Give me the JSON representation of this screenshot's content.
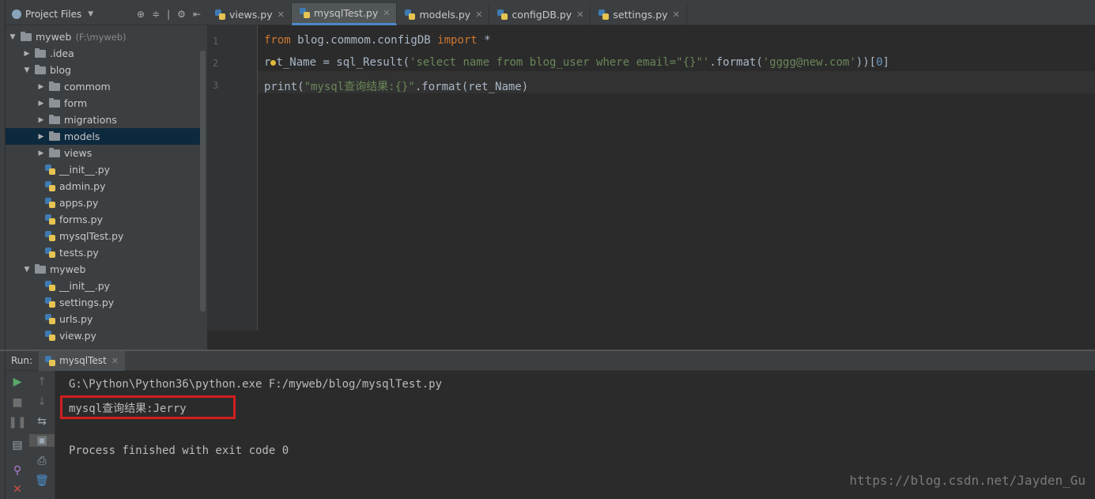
{
  "project_panel": {
    "title": "Project Files",
    "tree": [
      {
        "label": "myweb",
        "path": "(F:\\myweb)",
        "type": "folder",
        "depth": 0,
        "expanded": true
      },
      {
        "label": ".idea",
        "type": "folder",
        "depth": 1,
        "expanded": false
      },
      {
        "label": "blog",
        "type": "folder",
        "depth": 1,
        "expanded": true
      },
      {
        "label": "commom",
        "type": "folder",
        "depth": 2,
        "expanded": false
      },
      {
        "label": "form",
        "type": "folder",
        "depth": 2,
        "expanded": false
      },
      {
        "label": "migrations",
        "type": "folder",
        "depth": 2,
        "expanded": false
      },
      {
        "label": "models",
        "type": "folder",
        "depth": 2,
        "expanded": false,
        "selected": true
      },
      {
        "label": "views",
        "type": "folder",
        "depth": 2,
        "expanded": false
      },
      {
        "label": "__init__.py",
        "type": "file",
        "depth": 2
      },
      {
        "label": "admin.py",
        "type": "file",
        "depth": 2
      },
      {
        "label": "apps.py",
        "type": "file",
        "depth": 2
      },
      {
        "label": "forms.py",
        "type": "file",
        "depth": 2
      },
      {
        "label": "mysqlTest.py",
        "type": "file",
        "depth": 2
      },
      {
        "label": "tests.py",
        "type": "file",
        "depth": 2
      },
      {
        "label": "myweb",
        "type": "folder",
        "depth": 1,
        "expanded": true
      },
      {
        "label": "__init__.py",
        "type": "file",
        "depth": 2
      },
      {
        "label": "settings.py",
        "type": "file",
        "depth": 2
      },
      {
        "label": "urls.py",
        "type": "file",
        "depth": 2
      },
      {
        "label": "view.py",
        "type": "file",
        "depth": 2
      }
    ]
  },
  "editor_tabs": [
    {
      "label": "views.py",
      "active": false
    },
    {
      "label": "mysqlTest.py",
      "active": true
    },
    {
      "label": "models.py",
      "active": false
    },
    {
      "label": "configDB.py",
      "active": false
    },
    {
      "label": "settings.py",
      "active": false
    }
  ],
  "code": {
    "line_numbers": [
      "1",
      "2",
      "3"
    ],
    "line1": {
      "kw1": "from",
      "mod": " blog.commom.configDB ",
      "kw2": "import",
      "rest": " *"
    },
    "line2": {
      "a": "r",
      "b": "t_Name = sql_Result(",
      "s": "'select name from blog_user where email=\"{}\"'",
      "c": ".format(",
      "s2": "'gggg@new.com'",
      "d": "))[",
      "n": "0",
      "e": "]"
    },
    "line3": {
      "a": "print(",
      "s": "\"mysql查询结果:{}\"",
      "b": ".format(ret_Name)"
    }
  },
  "run_panel": {
    "label": "Run:",
    "tab": "mysqlTest",
    "output": [
      "G:\\Python\\Python36\\python.exe F:/myweb/blog/mysqlTest.py",
      "mysql查询结果:Jerry",
      "",
      "Process finished with exit code 0"
    ]
  },
  "watermark": "https://blog.csdn.net/Jayden_Gu",
  "colors": {
    "keyword": "#cc7832",
    "string": "#6a8759",
    "number": "#6897bb",
    "highlight_box": "#d11f1f"
  }
}
